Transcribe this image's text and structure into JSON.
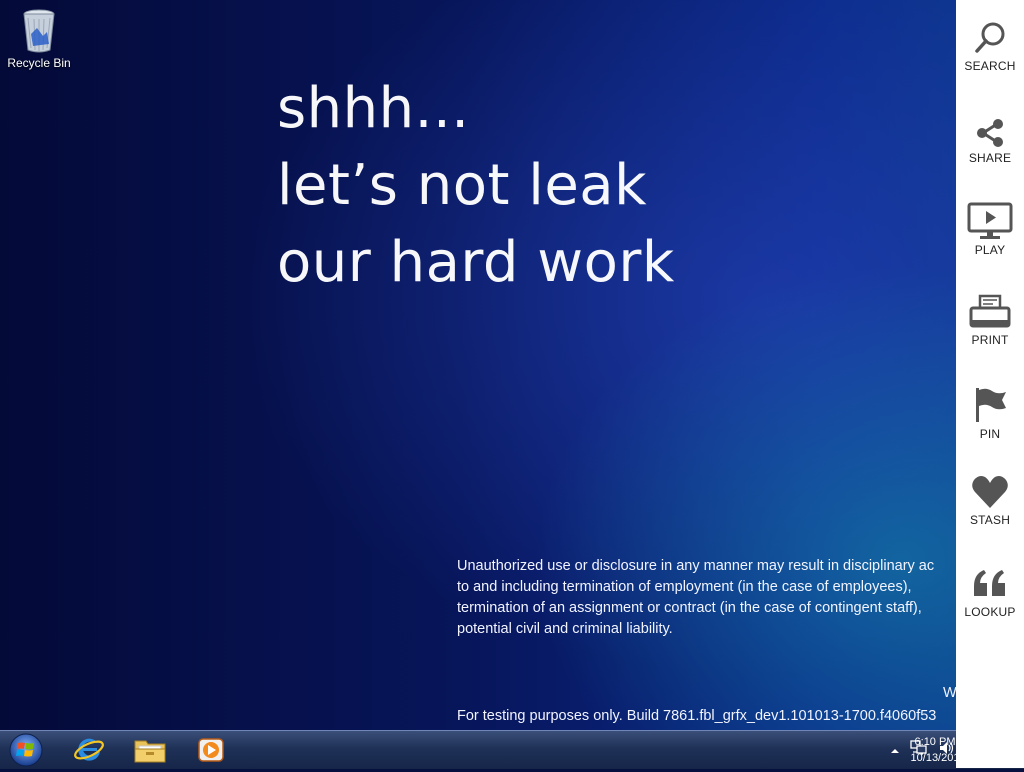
{
  "desktop": {
    "recycle_bin_label": "Recycle Bin",
    "headline": [
      "shhh...",
      "let’s not leak",
      "our hard work"
    ],
    "disclaimer": "Unauthorized use or disclosure in any manner may result in disciplinary ac\nto and including termination of employment (in the case of employees),\ntermination of an assignment or contract (in the case of contingent staff),\npotential civil and criminal liability.",
    "watermark_partial": "W",
    "build_text": "For testing purposes only. Build 7861.fbl_grfx_dev1.101013-1700.f4060f53"
  },
  "charms": [
    {
      "label": "SEARCH",
      "icon": "search-icon"
    },
    {
      "label": "SHARE",
      "icon": "share-icon"
    },
    {
      "label": "PLAY",
      "icon": "play-icon"
    },
    {
      "label": "PRINT",
      "icon": "printer-icon"
    },
    {
      "label": "PIN",
      "icon": "flag-icon"
    },
    {
      "label": "STASH",
      "icon": "heart-icon"
    },
    {
      "label": "LOOKUP",
      "icon": "quote-icon"
    }
  ],
  "taskbar": {
    "apps": [
      "internet-explorer-icon",
      "file-explorer-icon",
      "media-player-icon"
    ],
    "clock_time": "6:10 PM",
    "clock_date": "10/13/201"
  },
  "colors": {
    "charm_bar_bg": "#ffffff",
    "charm_icon": "#555555",
    "desktop_dark": "#040a38",
    "desktop_light": "#0d3a8e"
  }
}
